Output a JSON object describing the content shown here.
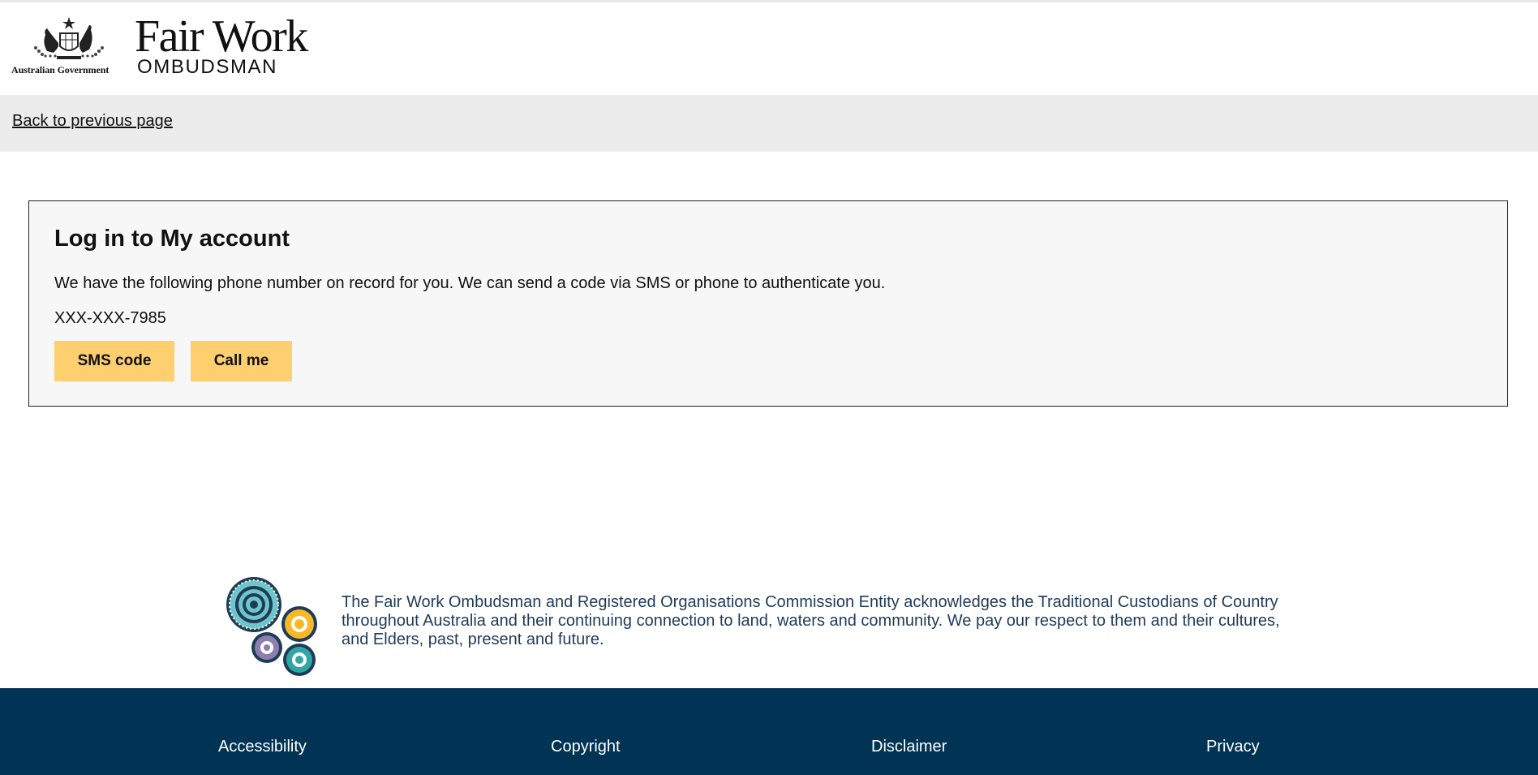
{
  "header": {
    "government_caption": "Australian Government",
    "brand_title": "Fair Work",
    "brand_subtitle": "OMBUDSMAN",
    "crest_icon": "commonwealth-coat-of-arms-icon"
  },
  "nav": {
    "back_label": "Back to previous page"
  },
  "login": {
    "title": "Log in to My account",
    "description": "We have the following phone number on record for you. We can send a code via SMS or phone to authenticate you.",
    "phone_masked": "XXX-XXX-7985",
    "sms_button": "SMS code",
    "call_button": "Call me",
    "button_color": "#fdcf6e"
  },
  "acknowledgement": {
    "art_icon": "aboriginal-dot-circles-icon",
    "text": "The Fair Work Ombudsman and Registered Organisations Commission Entity acknowledges the Traditional Custodians of Country throughout Australia and their continuing connection to land, waters and community. We pay our respect to them and their cultures, and Elders, past, present and future."
  },
  "footer": {
    "background": "#003354",
    "links": [
      "Accessibility",
      "Copyright",
      "Disclaimer",
      "Privacy"
    ]
  }
}
